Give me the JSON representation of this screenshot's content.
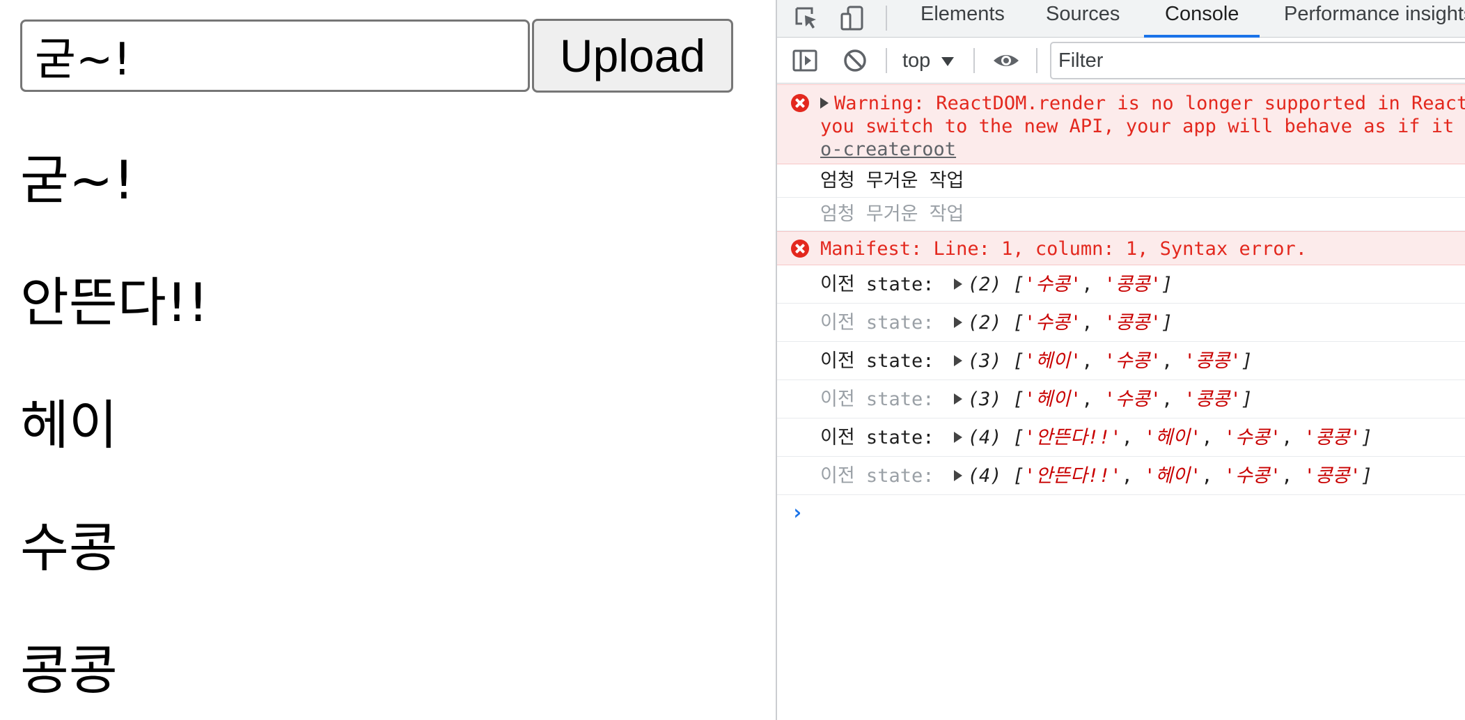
{
  "app": {
    "input_value": "굳~!",
    "upload_label": "Upload",
    "items": [
      "굳~!",
      "안뜬다!!",
      "헤이",
      "수콩",
      "콩콩"
    ]
  },
  "devtools": {
    "tabs": [
      {
        "label": "Elements",
        "active": false
      },
      {
        "label": "Sources",
        "active": false
      },
      {
        "label": "Console",
        "active": true
      },
      {
        "label": "Performance insights",
        "active": false
      }
    ],
    "toolbar": {
      "context": "top",
      "filter_placeholder": "Filter"
    },
    "messages": [
      {
        "kind": "error",
        "line1": "Warning: ReactDOM.render is no longer supported in React",
        "line2": "you switch to the new API, your app will behave as if it",
        "line3": "o-createroot"
      },
      {
        "kind": "log",
        "text": "엄청 무거운 작업"
      },
      {
        "kind": "log-repeat",
        "text": "엄청 무거운 작업"
      },
      {
        "kind": "error-simple",
        "text": "Manifest: Line: 1, column: 1, Syntax error."
      },
      {
        "kind": "state",
        "label": "이전 state:",
        "count": "(2)",
        "values": [
          "수콩",
          "콩콩"
        ]
      },
      {
        "kind": "state-repeat",
        "label": "이전 state:",
        "count": "(2)",
        "values": [
          "수콩",
          "콩콩"
        ]
      },
      {
        "kind": "state",
        "label": "이전 state:",
        "count": "(3)",
        "values": [
          "헤이",
          "수콩",
          "콩콩"
        ]
      },
      {
        "kind": "state-repeat",
        "label": "이전 state:",
        "count": "(3)",
        "values": [
          "헤이",
          "수콩",
          "콩콩"
        ]
      },
      {
        "kind": "state",
        "label": "이전 state:",
        "count": "(4)",
        "values": [
          "안뜬다!!",
          "헤이",
          "수콩",
          "콩콩"
        ]
      },
      {
        "kind": "state-repeat",
        "label": "이전 state:",
        "count": "(4)",
        "values": [
          "안뜬다!!",
          "헤이",
          "수콩",
          "콩콩"
        ]
      }
    ],
    "prompt": "›",
    "colors": {
      "accent": "#1a73e8",
      "error_text": "#e3281e",
      "error_bg": "#fcebeb",
      "string": "#c80000"
    }
  }
}
